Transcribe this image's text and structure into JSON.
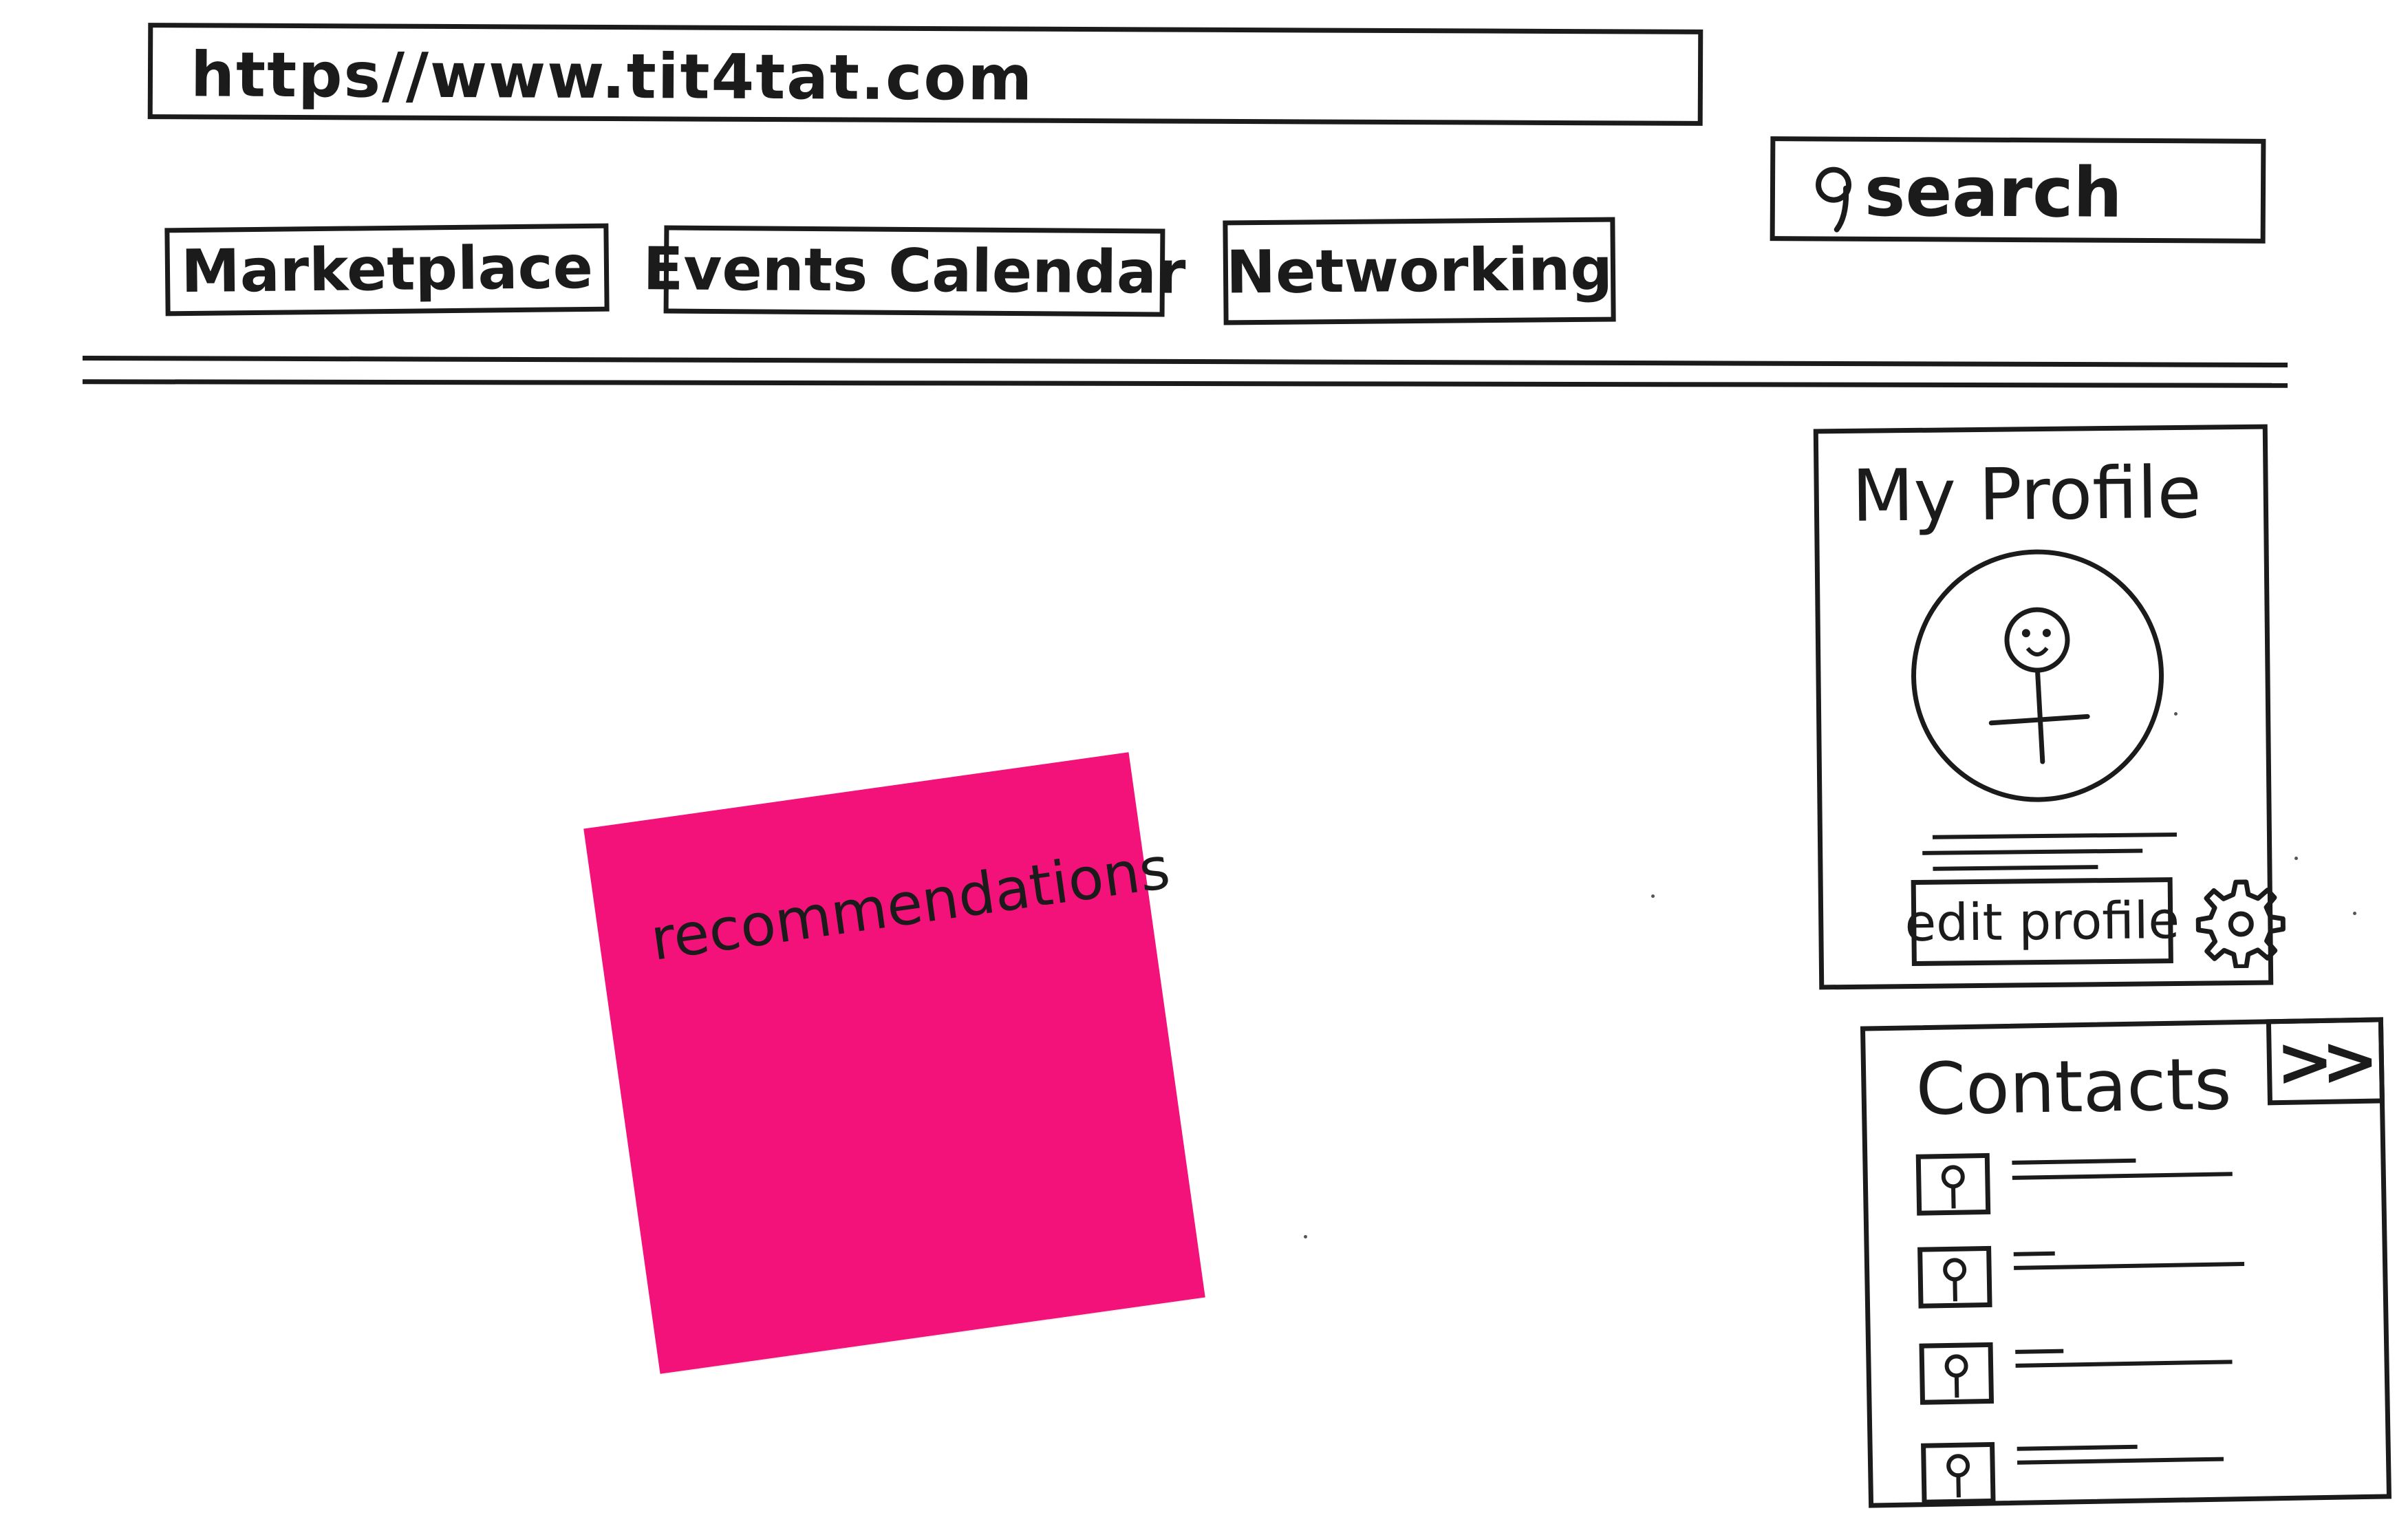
{
  "browser": {
    "url": "https//www.tit4tat.com"
  },
  "search": {
    "label": "search",
    "icon": "search-icon"
  },
  "nav": {
    "items": [
      {
        "label": "Marketplace"
      },
      {
        "label": "Events Calendar"
      },
      {
        "label": "Networking"
      }
    ]
  },
  "main": {
    "sticky_note": {
      "label": "recommendations",
      "color": "#f2127a"
    }
  },
  "profile": {
    "title": "My Profile",
    "avatar_icon": "stick-figure-avatar-icon",
    "edit_button": "edit profile",
    "settings_icon": "gear-icon"
  },
  "contacts": {
    "title": "Contacts",
    "expand_label": ">>",
    "rows": 4
  }
}
